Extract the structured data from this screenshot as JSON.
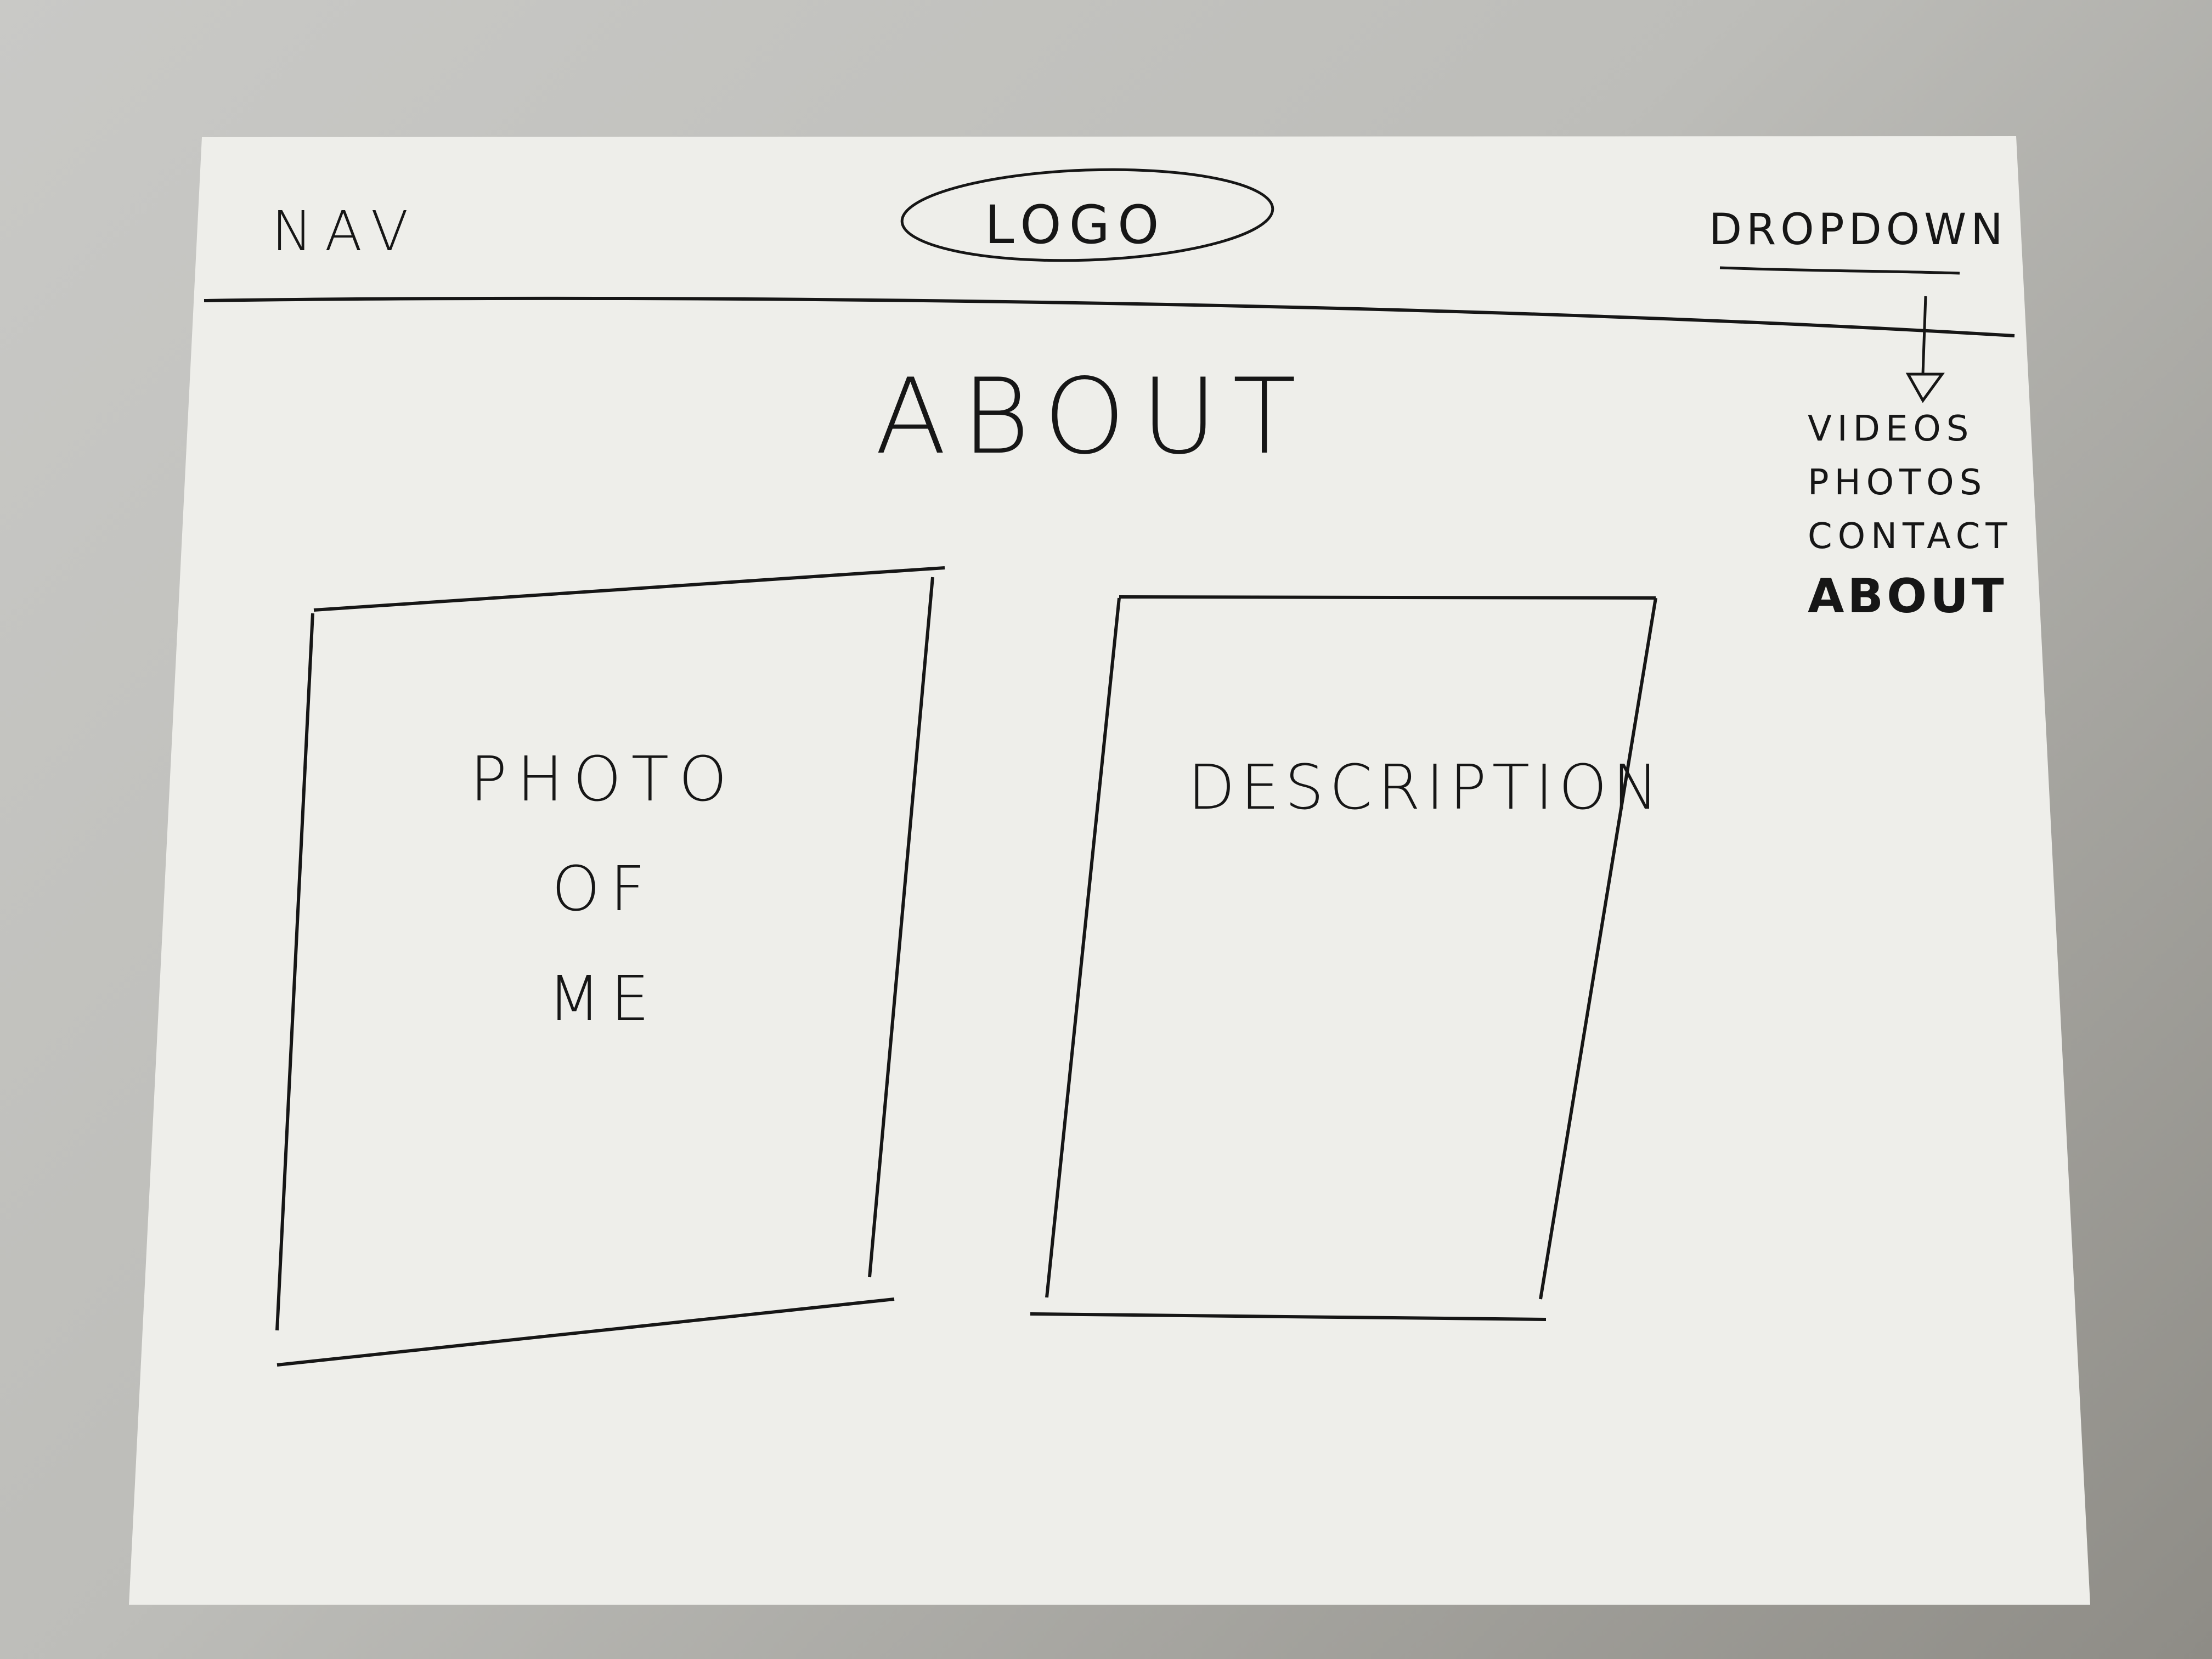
{
  "header": {
    "nav_label": "NAV",
    "logo_label": "LOGO",
    "dropdown_label": "DROPDOWN"
  },
  "page_title": "ABOUT",
  "dropdown_menu": {
    "items": [
      {
        "label": "VIDEOS"
      },
      {
        "label": "PHOTOS"
      },
      {
        "label": "CONTACT"
      },
      {
        "label": "ABOUT",
        "selected": true
      }
    ]
  },
  "photo_box": {
    "lines": [
      "PHOTO",
      "OF",
      "ME"
    ]
  },
  "description_box": {
    "label": "DESCRIPTION"
  },
  "colors": {
    "ink": "#161616",
    "paper": "#eeeeea",
    "background": "#bdbdb9"
  }
}
